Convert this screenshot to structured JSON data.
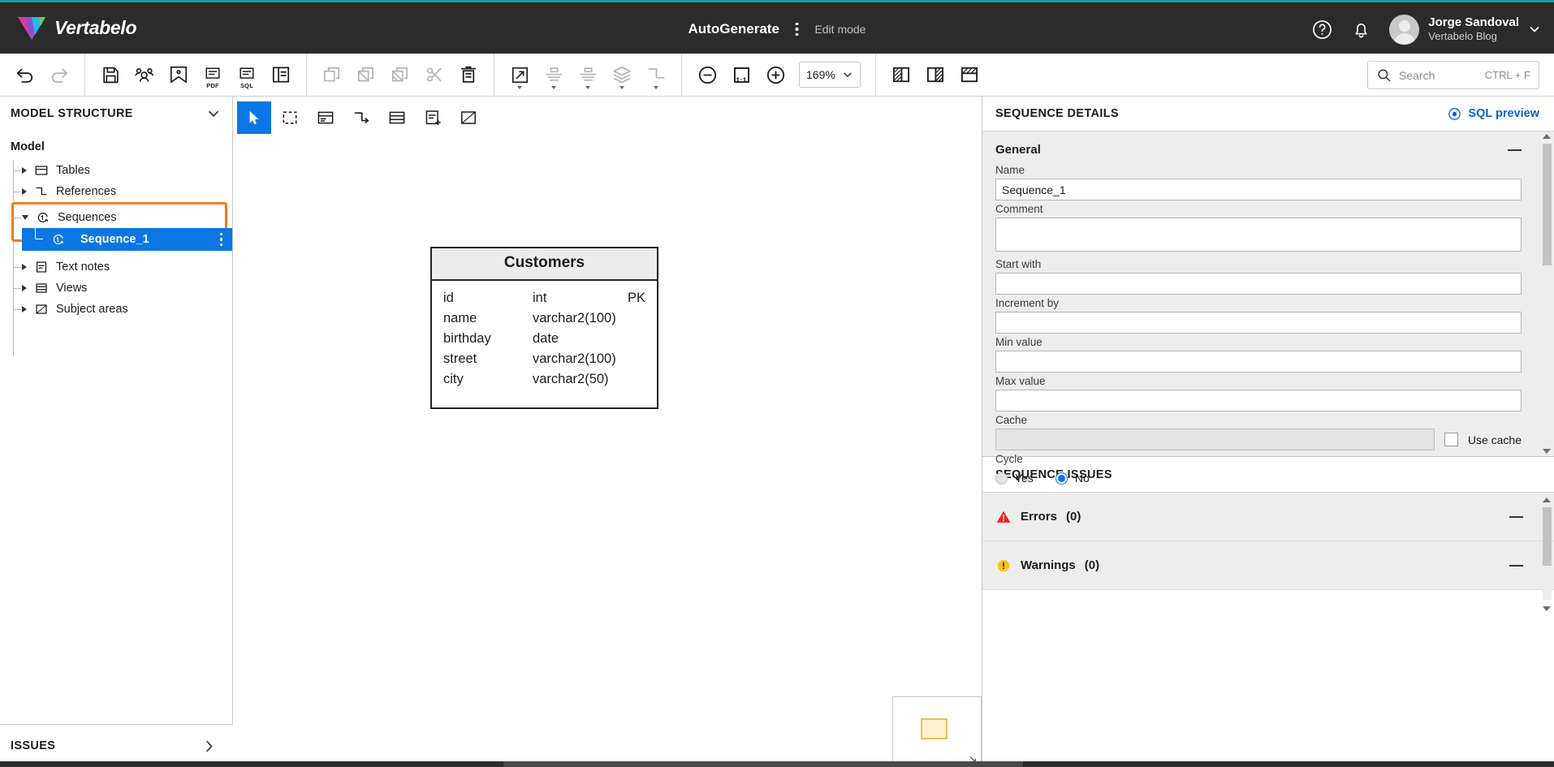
{
  "brand": {
    "name": "Vertabelo",
    "accent": "#21a0a0",
    "header_bg": "#2b2b2b"
  },
  "header": {
    "model_title": "AutoGenerate",
    "mode_label": "Edit mode",
    "kebab_icon": "kebab-menu-icon",
    "help_icon": "help-circle-icon",
    "bell_icon": "notification-bell-icon",
    "user": {
      "name": "Jorge Sandoval",
      "org": "Vertabelo Blog"
    }
  },
  "toolbar": {
    "groups": [
      {
        "name": "history",
        "buttons": [
          {
            "id": "undo",
            "icon": "undo-icon",
            "label": "",
            "disabled": false
          },
          {
            "id": "redo",
            "icon": "redo-icon",
            "label": "",
            "disabled": true
          }
        ]
      },
      {
        "name": "file",
        "buttons": [
          {
            "id": "save",
            "icon": "save-icon",
            "label": ""
          },
          {
            "id": "share",
            "icon": "share-users-icon",
            "label": ""
          },
          {
            "id": "export-image",
            "icon": "image-export-icon",
            "label": ""
          },
          {
            "id": "export-pdf",
            "icon": "pdf-export-icon",
            "label": "PDF"
          },
          {
            "id": "export-sql",
            "icon": "sql-export-icon",
            "label": "SQL"
          },
          {
            "id": "documentation",
            "icon": "documentation-icon",
            "label": ""
          }
        ]
      },
      {
        "name": "edit",
        "buttons": [
          {
            "id": "copy",
            "icon": "copy-icon",
            "label": "",
            "disabled": true
          },
          {
            "id": "paste",
            "icon": "paste-icon",
            "label": "",
            "disabled": true
          },
          {
            "id": "paste-special",
            "icon": "paste-special-icon",
            "label": "",
            "disabled": true
          },
          {
            "id": "cut",
            "icon": "scissors-icon",
            "label": "",
            "disabled": true
          },
          {
            "id": "delete",
            "icon": "trash-icon",
            "label": "",
            "disabled": false
          }
        ]
      },
      {
        "name": "arrange",
        "buttons": [
          {
            "id": "resize",
            "icon": "resize-arrows-icon",
            "label": "",
            "dropdown": true
          },
          {
            "id": "align",
            "icon": "align-icon",
            "label": "",
            "dropdown": true,
            "disabled": true
          },
          {
            "id": "distribute",
            "icon": "distribute-icon",
            "label": "",
            "dropdown": true,
            "disabled": true
          },
          {
            "id": "layers",
            "icon": "layers-icon",
            "label": "",
            "dropdown": true,
            "disabled": true
          },
          {
            "id": "route-lines",
            "icon": "line-routing-icon",
            "label": "",
            "dropdown": true,
            "disabled": true
          }
        ]
      },
      {
        "name": "zoom",
        "buttons": [
          {
            "id": "zoom-out",
            "icon": "zoom-out-icon",
            "label": ""
          },
          {
            "id": "zoom-reset",
            "icon": "zoom-1to1-icon",
            "label": "1:1"
          },
          {
            "id": "zoom-in",
            "icon": "zoom-in-icon",
            "label": ""
          }
        ]
      },
      {
        "name": "view",
        "buttons": [
          {
            "id": "view-left",
            "icon": "panel-left-icon",
            "label": ""
          },
          {
            "id": "view-right",
            "icon": "panel-right-icon",
            "label": ""
          },
          {
            "id": "view-top",
            "icon": "panel-top-icon",
            "label": ""
          }
        ]
      }
    ],
    "zoom_value": "169%",
    "zoom_caret_icon": "chevron-down-icon"
  },
  "search": {
    "icon": "search-icon",
    "placeholder": "Search",
    "shortcut": "CTRL + F"
  },
  "sidebar": {
    "title": "MODEL STRUCTURE",
    "collapse_icon": "chevron-down-icon",
    "root_label": "Model",
    "items": [
      {
        "label": "Tables",
        "icon": "table-icon",
        "expanded": false
      },
      {
        "label": "References",
        "icon": "reference-icon",
        "expanded": false
      },
      {
        "label": "Sequences",
        "icon": "sequence-icon",
        "expanded": true,
        "highlighted": true
      },
      {
        "label": "Text notes",
        "icon": "text-note-icon",
        "expanded": false
      },
      {
        "label": "Views",
        "icon": "view-icon",
        "expanded": false
      },
      {
        "label": "Subject areas",
        "icon": "subject-area-icon",
        "expanded": false
      }
    ],
    "selected_child": {
      "label": "Sequence_1",
      "icon": "sequence-icon",
      "selected": true
    },
    "footer": {
      "label": "ISSUES",
      "expand_icon": "chevron-right-icon"
    },
    "highlight_color": "#f07d18",
    "selection_color": "#0a77e4"
  },
  "canvas_tools": [
    {
      "id": "select",
      "icon": "cursor-arrow-icon",
      "active": true
    },
    {
      "id": "marquee",
      "icon": "marquee-select-icon",
      "active": false
    },
    {
      "id": "new-table",
      "icon": "new-table-icon",
      "active": false
    },
    {
      "id": "new-ref",
      "icon": "new-reference-icon",
      "active": false
    },
    {
      "id": "new-view",
      "icon": "new-view-icon",
      "active": false
    },
    {
      "id": "new-note",
      "icon": "new-text-note-icon",
      "active": false
    },
    {
      "id": "new-subject",
      "icon": "new-subject-area-icon",
      "active": false
    }
  ],
  "diagram": {
    "table": {
      "name": "Customers",
      "columns": [
        {
          "name": "id",
          "type": "int",
          "key": "PK"
        },
        {
          "name": "name",
          "type": "varchar2(100)",
          "key": ""
        },
        {
          "name": "birthday",
          "type": "date",
          "key": ""
        },
        {
          "name": "street",
          "type": "varchar2(100)",
          "key": ""
        },
        {
          "name": "city",
          "type": "varchar2(50)",
          "key": ""
        }
      ]
    },
    "minimap": {
      "name": "minimap",
      "resize_icon": "resize-grip-icon"
    }
  },
  "details": {
    "title": "SEQUENCE DETAILS",
    "sql_preview": {
      "label": "SQL preview",
      "icon": "eye-preview-icon"
    },
    "general": {
      "title": "General",
      "collapse_icon": "collapse-dash-icon",
      "fields": [
        {
          "label": "Name",
          "value": "Sequence_1",
          "type": "text"
        },
        {
          "label": "Comment",
          "value": "",
          "type": "textarea"
        },
        {
          "label": "Start with",
          "value": "",
          "type": "text"
        },
        {
          "label": "Increment by",
          "value": "",
          "type": "text"
        },
        {
          "label": "Min value",
          "value": "",
          "type": "text"
        },
        {
          "label": "Max value",
          "value": "",
          "type": "text"
        }
      ],
      "cache": {
        "label": "Cache",
        "value": "",
        "disabled": true,
        "checkbox_label": "Use cache",
        "checked": false
      },
      "cycle": {
        "label": "Cycle",
        "options": [
          "Yes",
          "No"
        ],
        "selected": "No"
      }
    }
  },
  "issues_panel": {
    "title": "SEQUENCE ISSUES",
    "rows": [
      {
        "label": "Errors",
        "count": "(0)",
        "icon": "error-triangle-icon",
        "color": "#ee2222"
      },
      {
        "label": "Warnings",
        "count": "(0)",
        "icon": "warning-circle-icon",
        "color": "#f5c518"
      }
    ]
  }
}
